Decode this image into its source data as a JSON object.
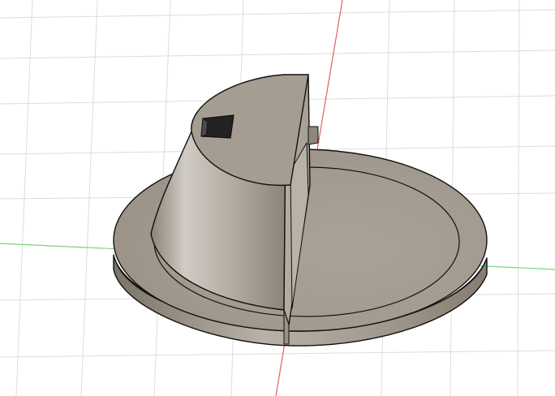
{
  "viewport": {
    "background": "#ffffff",
    "grid_color": "#dcdcdc",
    "x_axis_color": "#e06060",
    "y_axis_color": "#7ad67a"
  },
  "model": {
    "body_color": "#a9a093",
    "body_highlight": "#c8c2b8",
    "body_shadow": "#7f776c",
    "edge_color": "#111111",
    "pocket_color": "#222222"
  }
}
